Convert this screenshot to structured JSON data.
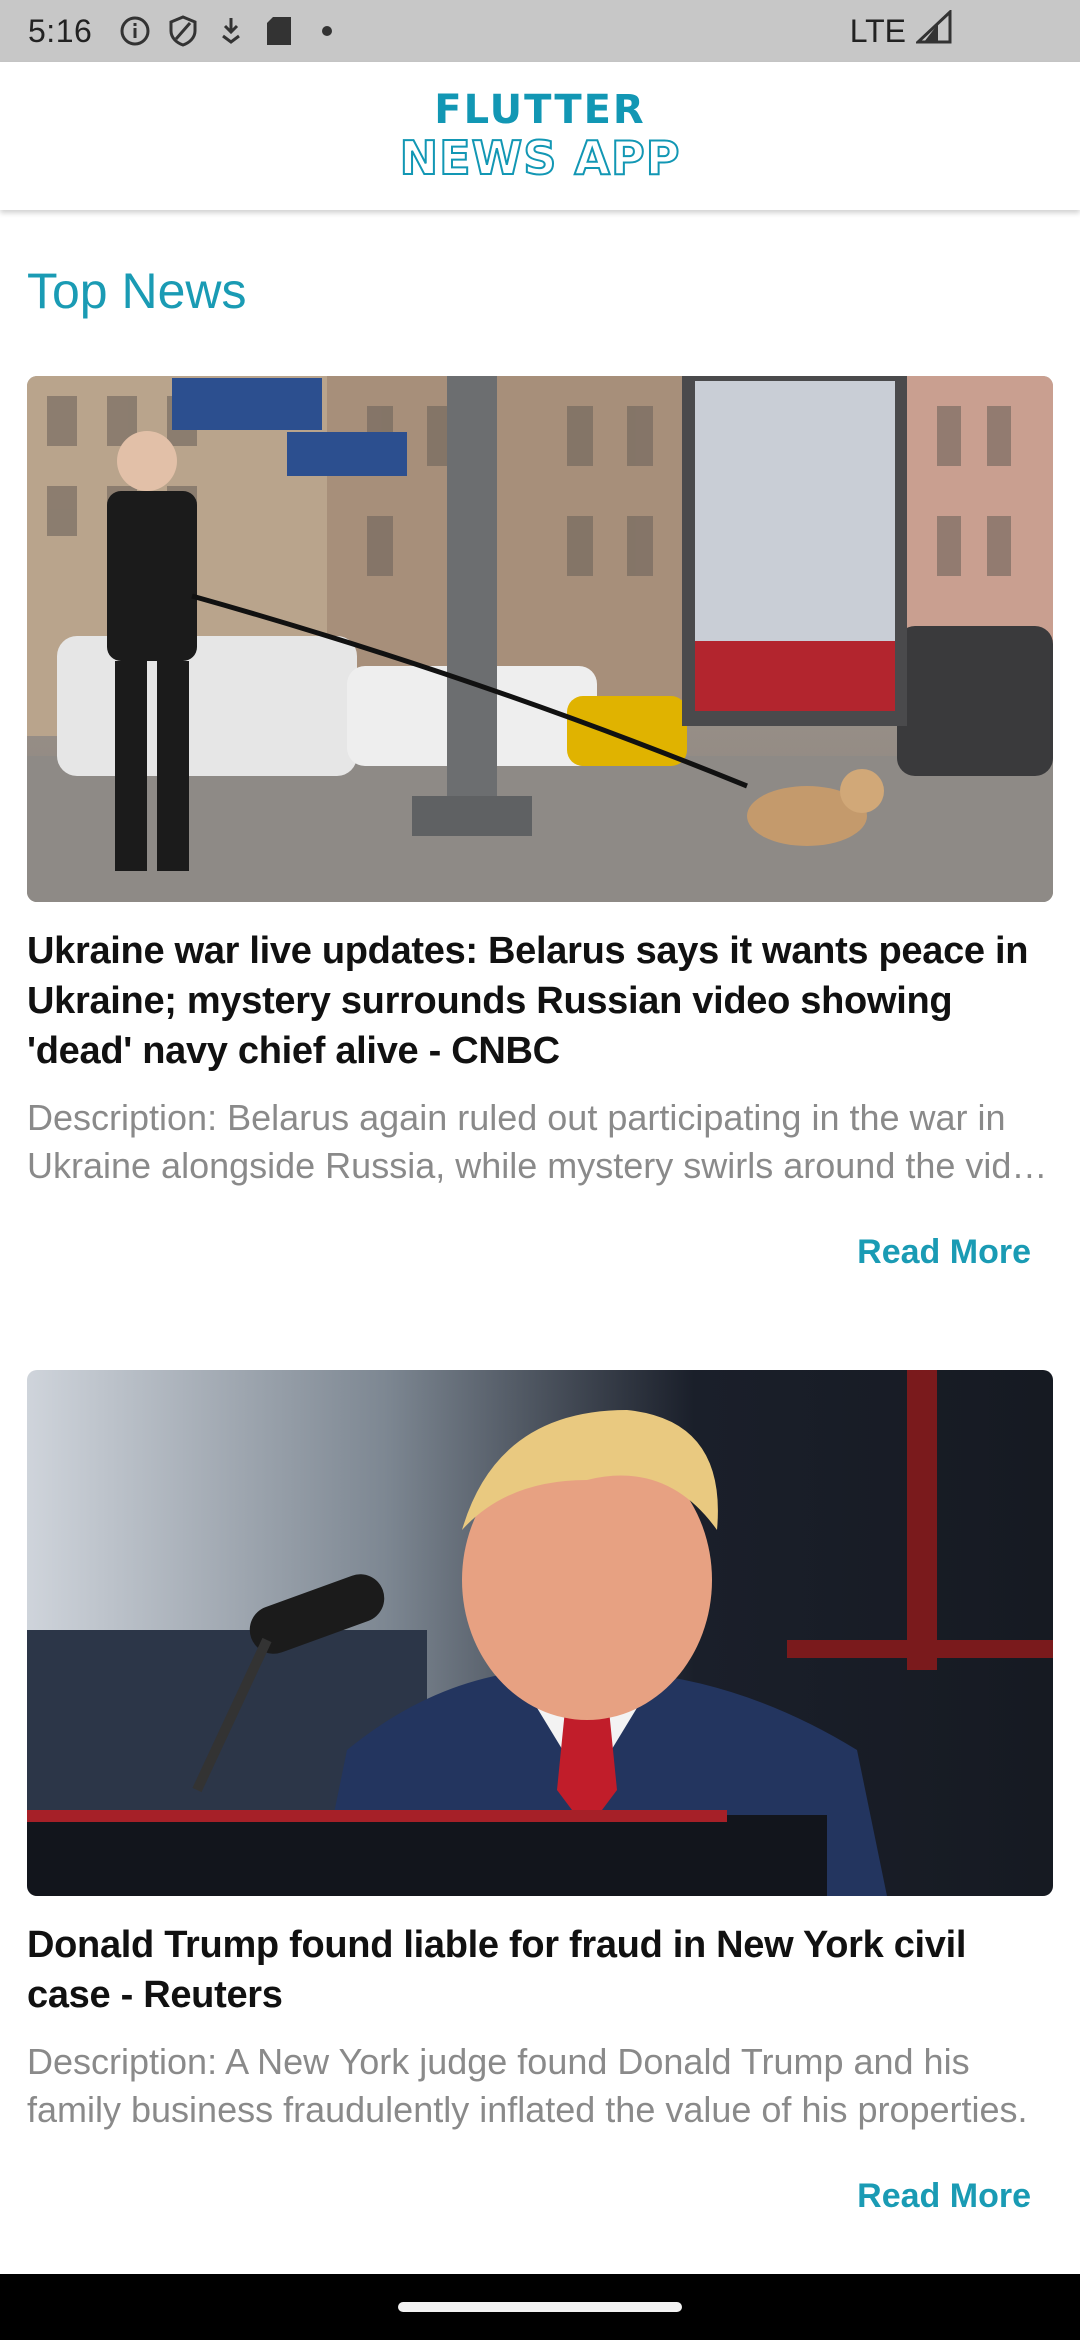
{
  "status_bar": {
    "time": "5:16",
    "network": "LTE",
    "icons": [
      "info-icon",
      "shield-icon",
      "download-icon",
      "sd-card-icon",
      "dot-icon",
      "signal-icon"
    ]
  },
  "app_bar": {
    "logo_line1": "FLUTTER",
    "logo_line2": "NEWS APP"
  },
  "main": {
    "section_title": "Top News",
    "articles": [
      {
        "image": "street-scene-photo",
        "title": "Ukraine war live updates: Belarus says it wants peace in Ukraine; mystery surrounds Russian video showing 'dead' navy chief alive - CNBC",
        "description": "Description: Belarus again ruled out participating in the war in Ukraine alongside Russia, while mystery swirls around the video showing the navy chief.",
        "read_more": "Read More"
      },
      {
        "image": "speaker-podium-photo",
        "title": "Donald Trump found liable for fraud in New York civil case - Reuters",
        "description": "Description: A New York judge found Donald Trump and his family business fraudulently inflated the value of his properties.",
        "read_more": "Read More"
      }
    ]
  },
  "colors": {
    "accent": "#1a9bb4",
    "status_bar_bg": "#c7c7c7",
    "description_text": "#8a8a8a"
  }
}
